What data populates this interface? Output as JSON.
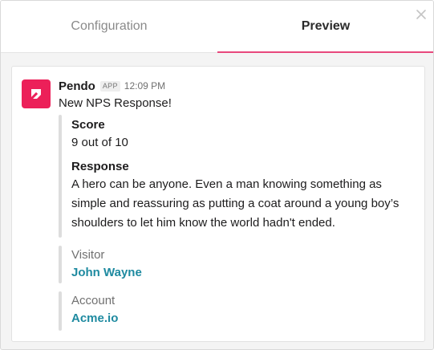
{
  "tabs": [
    {
      "label": "Configuration",
      "active": false
    },
    {
      "label": "Preview",
      "active": true
    }
  ],
  "close_icon": "close-icon",
  "accent_color": "#e8487c",
  "message": {
    "sender": "Pendo",
    "badge": "APP",
    "time": "12:09 PM",
    "text": "New NPS Response!",
    "avatar_color": "#ec2059",
    "avatar_icon": "pendo-logo-icon",
    "fields": [
      {
        "title": "Score",
        "value": "9 out of 10"
      },
      {
        "title": "Response",
        "value": "A hero can be anyone. Even a man knowing something as simple and reassuring as putting a coat around a young boy’s shoulders to let him know the world hadn't ended."
      }
    ],
    "visitor": {
      "label": "Visitor",
      "name": "John Wayne"
    },
    "account": {
      "label": "Account",
      "name": "Acme.io"
    },
    "link_color": "#1e8aa0"
  }
}
